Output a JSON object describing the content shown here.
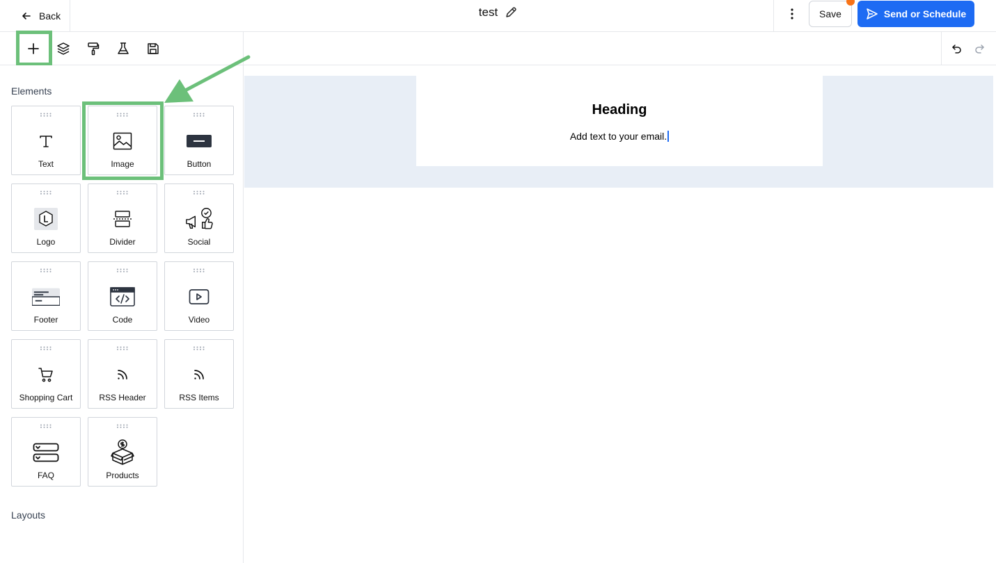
{
  "topbar": {
    "back_label": "Back",
    "title": "test",
    "save_label": "Save",
    "send_label": "Send or Schedule"
  },
  "toolbar": {
    "tools": [
      "add-icon",
      "layers-icon",
      "paint-roller-icon",
      "flask-icon",
      "floppy-disk-icon"
    ]
  },
  "sidebar": {
    "elements_heading": "Elements",
    "layouts_heading": "Layouts",
    "elements": [
      {
        "label": "Text",
        "icon": "text-icon"
      },
      {
        "label": "Image",
        "icon": "image-icon"
      },
      {
        "label": "Button",
        "icon": "button-icon"
      },
      {
        "label": "Logo",
        "icon": "logo-icon"
      },
      {
        "label": "Divider",
        "icon": "divider-icon"
      },
      {
        "label": "Social",
        "icon": "social-icon"
      },
      {
        "label": "Footer",
        "icon": "footer-icon"
      },
      {
        "label": "Code",
        "icon": "code-icon"
      },
      {
        "label": "Video",
        "icon": "video-icon"
      },
      {
        "label": "Shopping Cart",
        "icon": "cart-icon"
      },
      {
        "label": "RSS Header",
        "icon": "rss-icon"
      },
      {
        "label": "RSS Items",
        "icon": "rss-icon"
      },
      {
        "label": "FAQ",
        "icon": "faq-icon"
      },
      {
        "label": "Products",
        "icon": "products-icon"
      }
    ]
  },
  "email": {
    "heading": "Heading",
    "body": "Add text to your email."
  },
  "colors": {
    "primary": "#1d6bf3",
    "highlight": "#6cc07a",
    "notification": "#f97316",
    "canvas_band": "#e8eef6"
  }
}
